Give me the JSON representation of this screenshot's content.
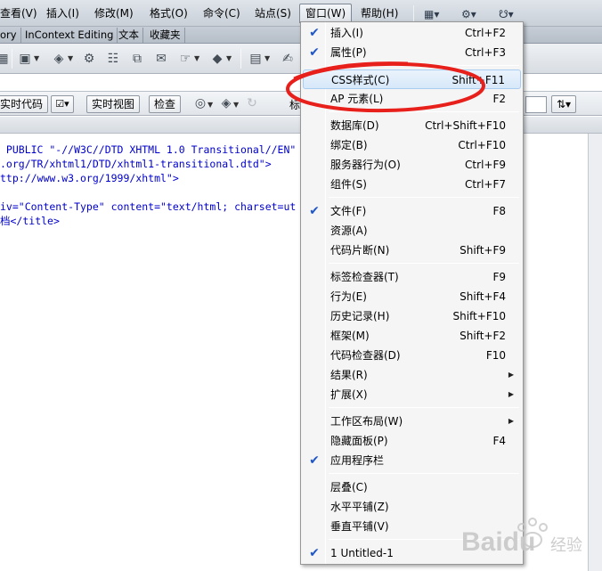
{
  "menubar": {
    "items": [
      "查看(V)",
      "插入(I)",
      "修改(M)",
      "格式(O)",
      "命令(C)",
      "站点(S)",
      "窗口(W)",
      "帮助(H)"
    ],
    "active_index": 6
  },
  "tabs": [
    "ory",
    "InContext Editing",
    "文本",
    "收藏夹"
  ],
  "doc_toolbar": {
    "live_code": "实时代码",
    "live_view": "实时视图",
    "inspect": "检查",
    "title_label": "标"
  },
  "code_lines": [
    " PUBLIC \"-//W3C//DTD XHTML 1.0 Transitional//EN\"",
    ".org/TR/xhtml1/DTD/xhtml1-transitional.dtd\">",
    "ttp://www.w3.org/1999/xhtml\">",
    "",
    "iv=\"Content-Type\" content=\"text/html; charset=ut",
    "档</title>"
  ],
  "window_menu": {
    "groups": [
      [
        {
          "label": "插入(I)",
          "shortcut": "Ctrl+F2",
          "checked": true
        },
        {
          "label": "属性(P)",
          "shortcut": "Ctrl+F3",
          "checked": true
        }
      ],
      [
        {
          "label": "CSS样式(C)",
          "shortcut": "Shift+F11",
          "checked": false,
          "highlighted": true
        },
        {
          "label": "AP 元素(L)",
          "shortcut": "F2",
          "checked": false
        }
      ],
      [
        {
          "label": "数据库(D)",
          "shortcut": "Ctrl+Shift+F10",
          "checked": false
        },
        {
          "label": "绑定(B)",
          "shortcut": "Ctrl+F10",
          "checked": false
        },
        {
          "label": "服务器行为(O)",
          "shortcut": "Ctrl+F9",
          "checked": false
        },
        {
          "label": "组件(S)",
          "shortcut": "Ctrl+F7",
          "checked": false
        }
      ],
      [
        {
          "label": "文件(F)",
          "shortcut": "F8",
          "checked": true
        },
        {
          "label": "资源(A)",
          "shortcut": "",
          "checked": false
        },
        {
          "label": "代码片断(N)",
          "shortcut": "Shift+F9",
          "checked": false
        }
      ],
      [
        {
          "label": "标签检查器(T)",
          "shortcut": "F9",
          "checked": false
        },
        {
          "label": "行为(E)",
          "shortcut": "Shift+F4",
          "checked": false
        },
        {
          "label": "历史记录(H)",
          "shortcut": "Shift+F10",
          "checked": false
        },
        {
          "label": "框架(M)",
          "shortcut": "Shift+F2",
          "checked": false
        },
        {
          "label": "代码检查器(D)",
          "shortcut": "F10",
          "checked": false
        },
        {
          "label": "结果(R)",
          "shortcut": "",
          "checked": false,
          "submenu": true
        },
        {
          "label": "扩展(X)",
          "shortcut": "",
          "checked": false,
          "submenu": true
        }
      ],
      [
        {
          "label": "工作区布局(W)",
          "shortcut": "",
          "checked": false,
          "submenu": true
        },
        {
          "label": "隐藏面板(P)",
          "shortcut": "F4",
          "checked": false
        },
        {
          "label": "应用程序栏",
          "shortcut": "",
          "checked": true
        }
      ],
      [
        {
          "label": "层叠(C)",
          "shortcut": "",
          "checked": false
        },
        {
          "label": "水平平铺(Z)",
          "shortcut": "",
          "checked": false
        },
        {
          "label": "垂直平铺(V)",
          "shortcut": "",
          "checked": false
        }
      ],
      [
        {
          "label": "1 Untitled-1",
          "shortcut": "",
          "checked": true
        }
      ]
    ]
  },
  "watermark": {
    "text": "Baidu",
    "sub": "经验"
  },
  "colors": {
    "annotation": "#e8201c",
    "check": "#1f56c8",
    "code": "#0000cc"
  }
}
